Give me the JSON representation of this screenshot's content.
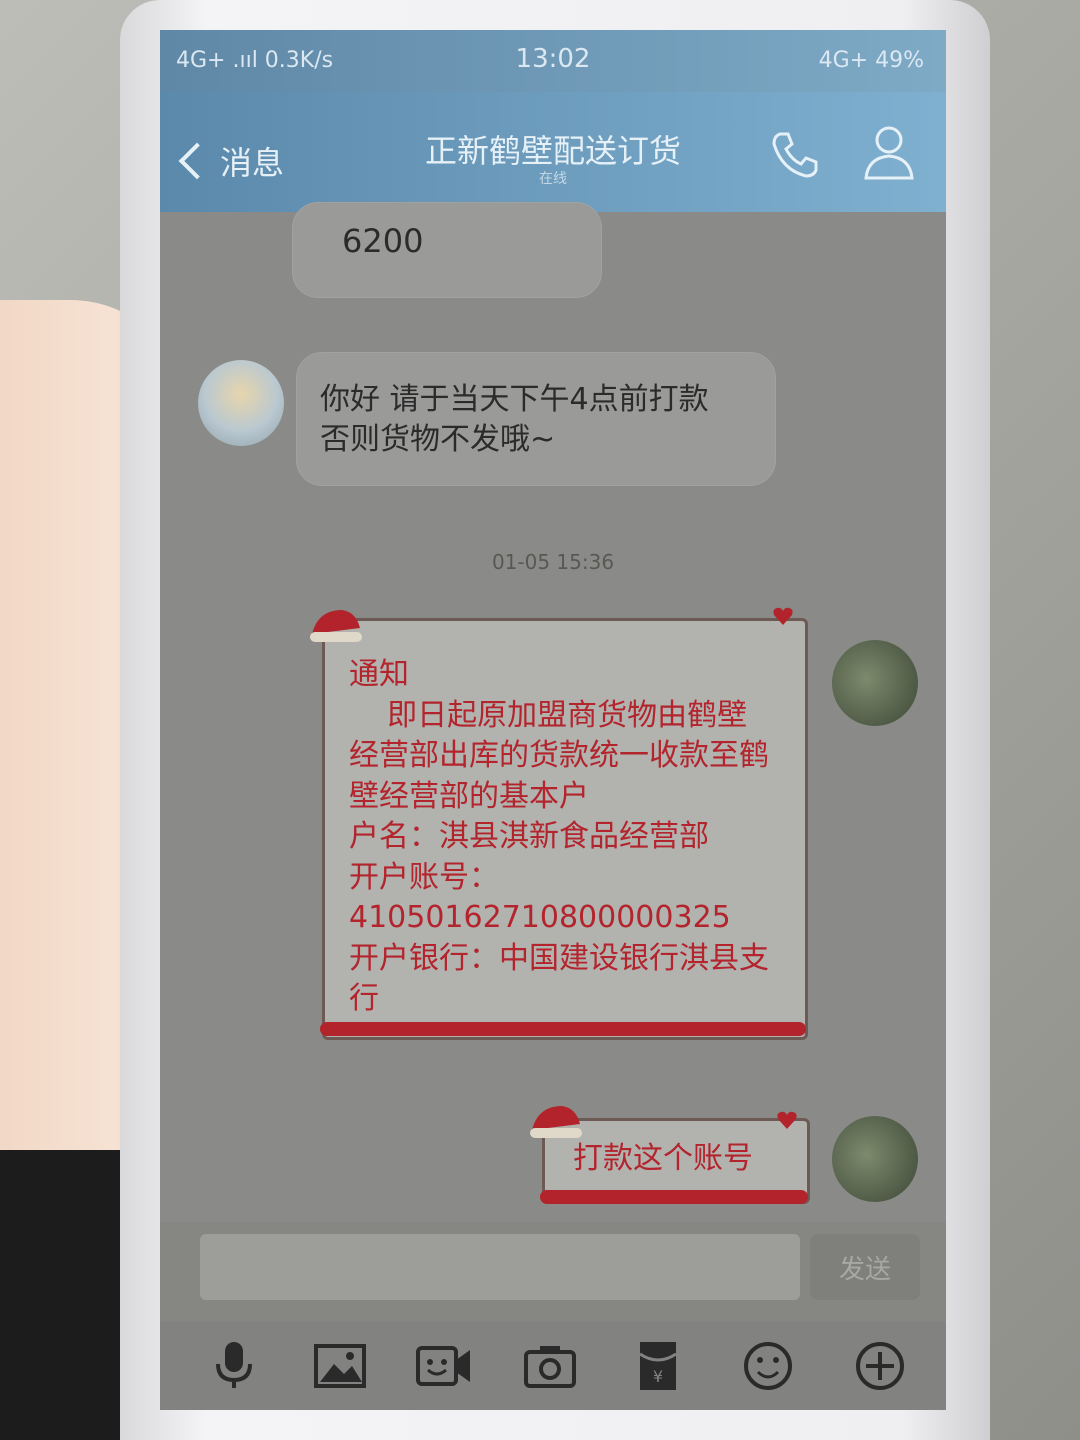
{
  "status_bar": {
    "left": "4G+ .ııl 0.3K/s",
    "time": "13:02",
    "right": "4G+ 49%"
  },
  "nav": {
    "back_label": "消息",
    "title": "正新鹤壁配送订货",
    "subtitle": "在线"
  },
  "messages": {
    "amount": "6200",
    "payment_notice": "你好 请于当天下午4点前打款 否则货物不发哦~",
    "timestamp": "01-05 15:36",
    "notice_card": "通知\n    即日起原加盟商货物由鹤壁经营部出库的货款统一收款至鹤壁经营部的基本户\n户名：淇县淇新食品经营部\n开户账号：\n41050162710800000325\n开户银行：中国建设银行淇县支行",
    "short_card": "打款这个账号"
  },
  "input": {
    "send_label": "发送"
  },
  "toolbar": {
    "icons": [
      "microphone-icon",
      "image-icon",
      "video-icon",
      "camera-icon",
      "red-packet-icon",
      "emoji-icon",
      "plus-icon"
    ]
  },
  "colors": {
    "card_text": "#b3242d",
    "nav_bg": "#6b9cc0"
  }
}
